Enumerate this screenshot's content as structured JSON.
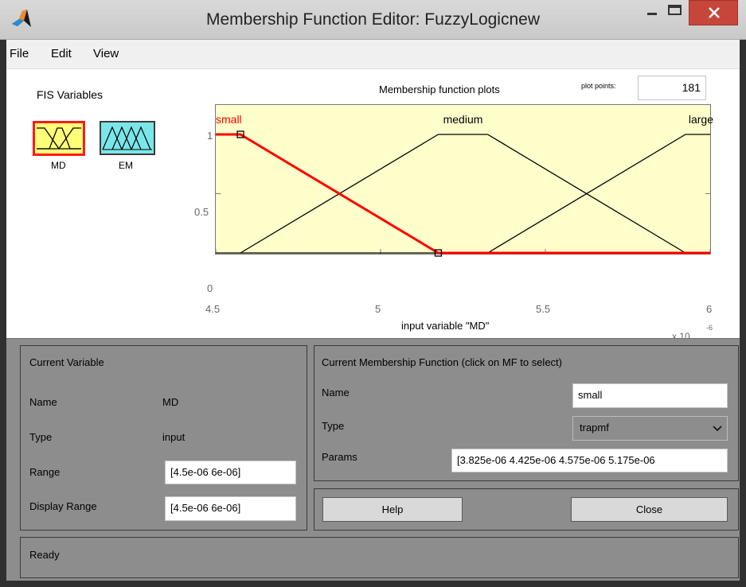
{
  "window": {
    "title": "Membership Function Editor: FuzzyLogicnew",
    "controls": {
      "minimize": "minimize",
      "maximize": "maximize",
      "close": "close"
    }
  },
  "menu": [
    "File",
    "Edit",
    "View"
  ],
  "fis": {
    "title": "FIS Variables",
    "variables": [
      {
        "name": "MD",
        "selected": true,
        "color": "#ffff7a"
      },
      {
        "name": "EM",
        "selected": false,
        "color": "#7ae6ea"
      }
    ]
  },
  "plot": {
    "title": "Membership function plots",
    "plot_points_label": "plot points:",
    "plot_points_value": "181",
    "xlabel": "input variable \"MD\"",
    "exponent": "x 10",
    "exponent_power": "-6"
  },
  "chart_data": {
    "type": "line",
    "xlim": [
      4.5,
      6
    ],
    "ylim": [
      0,
      1
    ],
    "xticks": [
      "4.5",
      "5",
      "5.5",
      "6"
    ],
    "yticks": [
      "0",
      "0.5",
      "1"
    ],
    "series": [
      {
        "name": "small",
        "color": "#ff0000",
        "selected": true,
        "x": [
          4.5,
          4.575,
          5.175,
          6
        ],
        "y": [
          1,
          1,
          0,
          0
        ]
      },
      {
        "name": "medium",
        "color": "#000000",
        "selected": false,
        "x": [
          4.575,
          5.175,
          5.325,
          5.925
        ],
        "y": [
          0,
          1,
          1,
          0
        ]
      },
      {
        "name": "large",
        "color": "#000000",
        "selected": false,
        "x": [
          4.5,
          5.325,
          5.925,
          6
        ],
        "y": [
          0,
          0,
          1,
          1
        ]
      }
    ]
  },
  "current_variable": {
    "title": "Current Variable",
    "name_label": "Name",
    "name_value": "MD",
    "type_label": "Type",
    "type_value": "input",
    "range_label": "Range",
    "range_value": "[4.5e-06 6e-06]",
    "display_range_label": "Display Range",
    "display_range_value": "[4.5e-06 6e-06]"
  },
  "current_mf": {
    "title": "Current Membership Function (click on MF to select)",
    "name_label": "Name",
    "name_value": "small",
    "type_label": "Type",
    "type_value": "trapmf",
    "params_label": "Params",
    "params_value": "[3.825e-06 4.425e-06 4.575e-06 5.175e-06"
  },
  "buttons": {
    "help": "Help",
    "close": "Close"
  },
  "status": "Ready"
}
